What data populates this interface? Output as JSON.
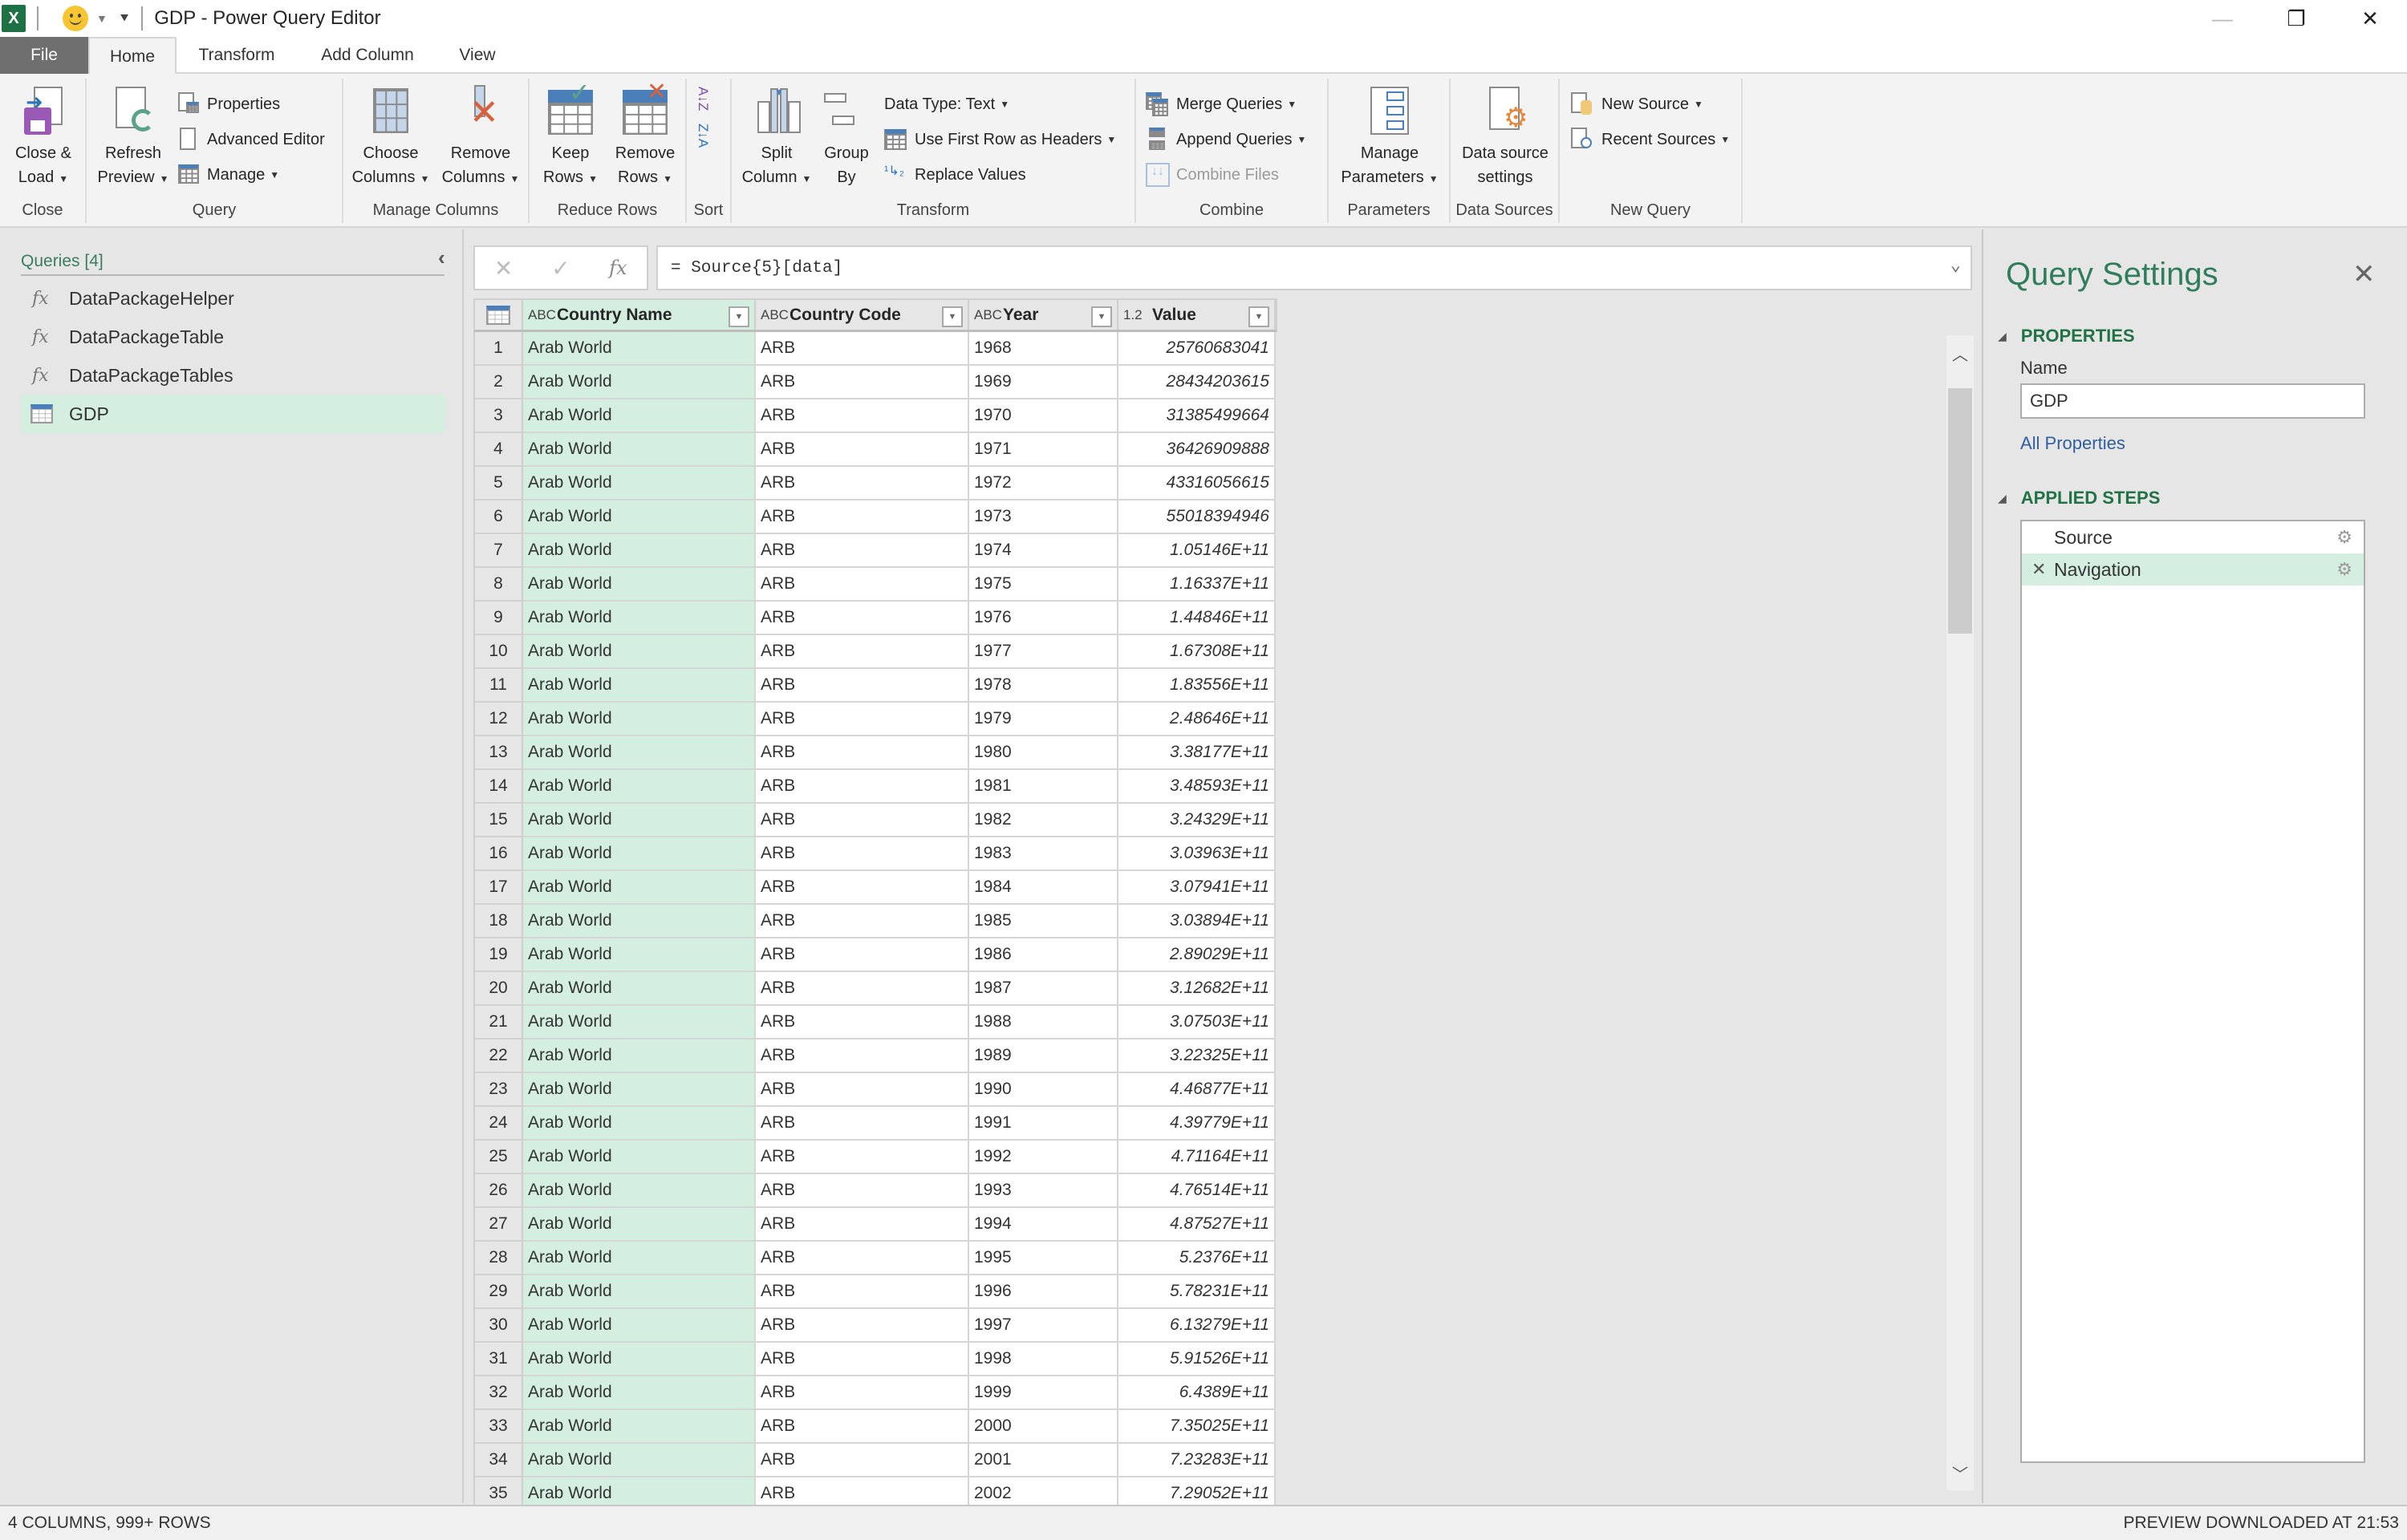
{
  "titlebar": {
    "app_icon": "excel-icon",
    "app_icon_text": "X",
    "title": "GDP - Power Query Editor",
    "controls": {
      "minimize": "—",
      "restore": "❐",
      "close": "✕"
    }
  },
  "tabs": [
    {
      "label": "File"
    },
    {
      "label": "Home",
      "active": true
    },
    {
      "label": "Transform"
    },
    {
      "label": "Add Column"
    },
    {
      "label": "View"
    }
  ],
  "ribbon": {
    "collapse_glyph": "︿",
    "help_glyph": "?",
    "groups": {
      "close": {
        "label": "Close",
        "close_load": [
          "Close &",
          "Load"
        ]
      },
      "query": {
        "label": "Query",
        "refresh": [
          "Refresh",
          "Preview"
        ],
        "properties": "Properties",
        "advanced_editor": "Advanced Editor",
        "manage": "Manage"
      },
      "manage_columns": {
        "label": "Manage Columns",
        "choose": [
          "Choose",
          "Columns"
        ],
        "remove": [
          "Remove",
          "Columns"
        ]
      },
      "reduce_rows": {
        "label": "Reduce Rows",
        "keep": [
          "Keep",
          "Rows"
        ],
        "remove": [
          "Remove",
          "Rows"
        ]
      },
      "sort": {
        "label": "Sort",
        "asc": "A↓Z",
        "desc": "Z↓A"
      },
      "transform": {
        "label": "Transform",
        "split": [
          "Split",
          "Column"
        ],
        "group": [
          "Group",
          "By"
        ],
        "data_type": "Data Type: Text",
        "first_row": "Use First Row as Headers",
        "replace": "Replace Values"
      },
      "combine": {
        "label": "Combine",
        "merge": "Merge Queries",
        "append": "Append Queries",
        "combine_files": "Combine Files"
      },
      "parameters": {
        "label": "Parameters",
        "manage": [
          "Manage",
          "Parameters"
        ]
      },
      "data_sources": {
        "label": "Data Sources",
        "settings": [
          "Data source",
          "settings"
        ]
      },
      "new_query": {
        "label": "New Query",
        "new_source": "New Source",
        "recent_sources": "Recent Sources"
      }
    }
  },
  "queries_pane": {
    "title": "Queries [4]",
    "collapse_glyph": "‹",
    "items": [
      {
        "label": "DataPackageHelper",
        "icon": "fx",
        "type": "function"
      },
      {
        "label": "DataPackageTable",
        "icon": "fx",
        "type": "function"
      },
      {
        "label": "DataPackageTables",
        "icon": "fx",
        "type": "function"
      },
      {
        "label": "GDP",
        "icon": "table",
        "type": "table",
        "selected": true
      }
    ]
  },
  "formula_bar": {
    "cancel": "✕",
    "commit": "✓",
    "fx": "fx",
    "formula": "= Source{5}[data]",
    "expand": "⌄"
  },
  "grid": {
    "columns": [
      {
        "type": "ABC",
        "name": "Country Name"
      },
      {
        "type": "ABC",
        "name": "Country Code"
      },
      {
        "type": "ABC",
        "name": "Year"
      },
      {
        "type": "1.2",
        "name": "Value"
      }
    ],
    "rows": [
      [
        "1",
        "Arab World",
        "ARB",
        "1968",
        "25760683041"
      ],
      [
        "2",
        "Arab World",
        "ARB",
        "1969",
        "28434203615"
      ],
      [
        "3",
        "Arab World",
        "ARB",
        "1970",
        "31385499664"
      ],
      [
        "4",
        "Arab World",
        "ARB",
        "1971",
        "36426909888"
      ],
      [
        "5",
        "Arab World",
        "ARB",
        "1972",
        "43316056615"
      ],
      [
        "6",
        "Arab World",
        "ARB",
        "1973",
        "55018394946"
      ],
      [
        "7",
        "Arab World",
        "ARB",
        "1974",
        "1.05146E+11"
      ],
      [
        "8",
        "Arab World",
        "ARB",
        "1975",
        "1.16337E+11"
      ],
      [
        "9",
        "Arab World",
        "ARB",
        "1976",
        "1.44846E+11"
      ],
      [
        "10",
        "Arab World",
        "ARB",
        "1977",
        "1.67308E+11"
      ],
      [
        "11",
        "Arab World",
        "ARB",
        "1978",
        "1.83556E+11"
      ],
      [
        "12",
        "Arab World",
        "ARB",
        "1979",
        "2.48646E+11"
      ],
      [
        "13",
        "Arab World",
        "ARB",
        "1980",
        "3.38177E+11"
      ],
      [
        "14",
        "Arab World",
        "ARB",
        "1981",
        "3.48593E+11"
      ],
      [
        "15",
        "Arab World",
        "ARB",
        "1982",
        "3.24329E+11"
      ],
      [
        "16",
        "Arab World",
        "ARB",
        "1983",
        "3.03963E+11"
      ],
      [
        "17",
        "Arab World",
        "ARB",
        "1984",
        "3.07941E+11"
      ],
      [
        "18",
        "Arab World",
        "ARB",
        "1985",
        "3.03894E+11"
      ],
      [
        "19",
        "Arab World",
        "ARB",
        "1986",
        "2.89029E+11"
      ],
      [
        "20",
        "Arab World",
        "ARB",
        "1987",
        "3.12682E+11"
      ],
      [
        "21",
        "Arab World",
        "ARB",
        "1988",
        "3.07503E+11"
      ],
      [
        "22",
        "Arab World",
        "ARB",
        "1989",
        "3.22325E+11"
      ],
      [
        "23",
        "Arab World",
        "ARB",
        "1990",
        "4.46877E+11"
      ],
      [
        "24",
        "Arab World",
        "ARB",
        "1991",
        "4.39779E+11"
      ],
      [
        "25",
        "Arab World",
        "ARB",
        "1992",
        "4.71164E+11"
      ],
      [
        "26",
        "Arab World",
        "ARB",
        "1993",
        "4.76514E+11"
      ],
      [
        "27",
        "Arab World",
        "ARB",
        "1994",
        "4.87527E+11"
      ],
      [
        "28",
        "Arab World",
        "ARB",
        "1995",
        "5.2376E+11"
      ],
      [
        "29",
        "Arab World",
        "ARB",
        "1996",
        "5.78231E+11"
      ],
      [
        "30",
        "Arab World",
        "ARB",
        "1997",
        "6.13279E+11"
      ],
      [
        "31",
        "Arab World",
        "ARB",
        "1998",
        "5.91526E+11"
      ],
      [
        "32",
        "Arab World",
        "ARB",
        "1999",
        "6.4389E+11"
      ],
      [
        "33",
        "Arab World",
        "ARB",
        "2000",
        "7.35025E+11"
      ],
      [
        "34",
        "Arab World",
        "ARB",
        "2001",
        "7.23283E+11"
      ],
      [
        "35",
        "Arab World",
        "ARB",
        "2002",
        "7.29052E+11"
      ]
    ],
    "selected_column": "Country Name",
    "scroll_up": "︿",
    "scroll_down": "﹀"
  },
  "settings_pane": {
    "title": "Query Settings",
    "close": "✕",
    "properties_heading": "PROPERTIES",
    "name_label": "Name",
    "name_value": "GDP",
    "all_properties": "All Properties",
    "steps_heading": "APPLIED STEPS",
    "steps": [
      {
        "label": "Source",
        "gear": "⚙"
      },
      {
        "label": "Navigation",
        "gear": "⚙",
        "selected": true,
        "delete": "✕"
      }
    ],
    "triangle": "◢"
  },
  "statusbar": {
    "left": "4 COLUMNS, 999+ ROWS",
    "right": "PREVIEW DOWNLOADED AT 21:53"
  },
  "colors": {
    "accent_green": "#217346",
    "selection_green": "#d4eee0",
    "link_blue": "#2f5fa0",
    "file_tab": "#6f6f6f"
  }
}
